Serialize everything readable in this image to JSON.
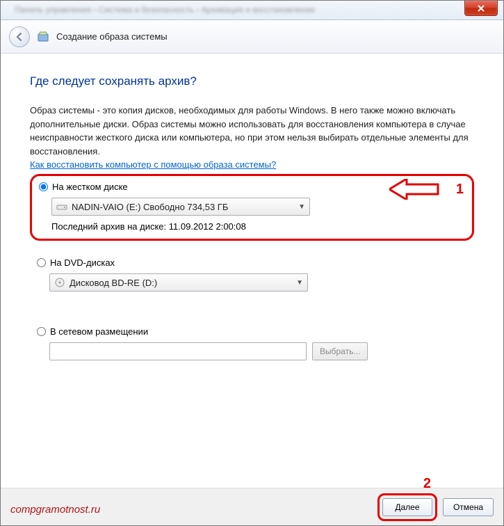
{
  "titlebar": {
    "breadcrumb_blur": "Панель управления  ›  Система и безопасность  ›  Архивация и восстановление"
  },
  "header": {
    "title": "Создание образа системы"
  },
  "main": {
    "question": "Где следует сохранять архив?",
    "description": "Образ системы - это копия дисков, необходимых для работы Windows. В него также можно включать дополнительные диски. Образ системы можно использовать для восстановления компьютера в случае неисправности жесткого диска или компьютера, но при этом нельзя выбирать отдельные элементы для восстановления.",
    "help_link": "Как восстановить компьютер с помощью образа системы?"
  },
  "option_hd": {
    "label": "На жестком диске",
    "combo": "NADIN-VAIO (E:)  Свободно 734,53 ГБ",
    "last_backup_label": "Последний архив на диске:",
    "last_backup_value": "11.09.2012 2:00:08",
    "annotation_num": "1"
  },
  "option_dvd": {
    "label": "На DVD-дисках",
    "combo": "Дисковод BD-RE (D:)"
  },
  "option_net": {
    "label": "В сетевом размещении",
    "browse": "Выбрать..."
  },
  "footer": {
    "next": "Далее",
    "cancel": "Отмена",
    "annotation_num": "2"
  },
  "watermark": "compgramotnost.ru"
}
